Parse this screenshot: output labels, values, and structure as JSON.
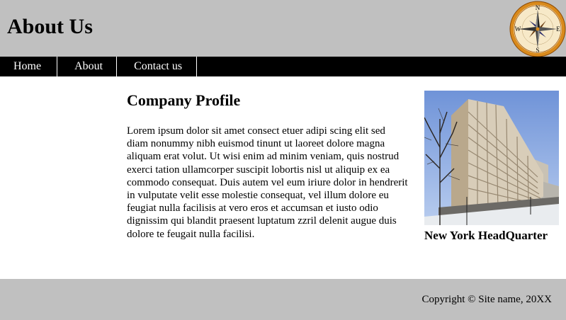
{
  "header": {
    "title": "About Us",
    "logo": {
      "icon": "compass-rose-icon",
      "north": "N",
      "south": "S",
      "east": "E",
      "west": "W"
    }
  },
  "nav": {
    "items": [
      {
        "label": "Home"
      },
      {
        "label": "About"
      },
      {
        "label": "Contact us"
      }
    ]
  },
  "main": {
    "title": "Company Profile",
    "body": "Lorem ipsum dolor sit amet consect etuer adipi scing elit sed diam nonummy nibh euismod tinunt ut laoreet dolore magna aliquam erat volut. Ut wisi enim ad minim veniam, quis nostrud exerci tation ullamcorper suscipit lobortis nisl ut aliquip ex ea commodo consequat. Duis autem vel eum iriure dolor in hendrerit in vulputate velit esse molestie consequat, vel illum dolore eu feugiat nulla facilisis at vero eros et accumsan et iusto odio dignissim qui blandit praesent luptatum zzril delenit augue duis dolore te feugait nulla facilisi."
  },
  "aside": {
    "image": "office-building-photo",
    "caption": "New York HeadQuarter"
  },
  "footer": {
    "copyright": "Copyright © Site name, 20XX"
  },
  "colors": {
    "header_bg": "#c0c0c0",
    "nav_bg": "#000000",
    "footer_bg": "#c0c0c0"
  }
}
